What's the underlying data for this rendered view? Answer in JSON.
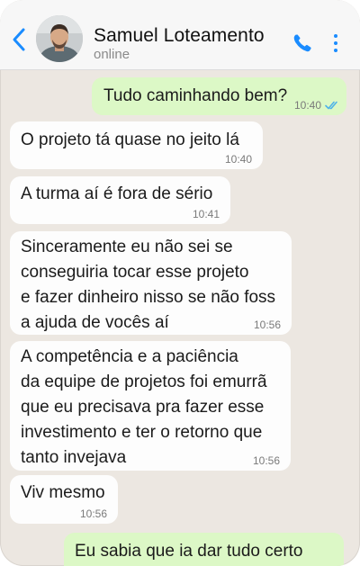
{
  "header": {
    "contact_name": "Samuel Loteamento",
    "status": "online"
  },
  "messages": [
    {
      "direction": "out",
      "text": "Tudo caminhando bem?",
      "time": "10:40",
      "read": true
    },
    {
      "direction": "in",
      "text": "O projeto tá quase no jeito lá",
      "time": "10:40"
    },
    {
      "direction": "in",
      "text": "A turma aí é fora de sério",
      "time": "10:41"
    },
    {
      "direction": "in",
      "lines": [
        "Sinceramente eu não sei se",
        "conseguiria tocar esse projeto",
        "e fazer dinheiro nisso se não foss",
        "a ajuda de vocês aí"
      ],
      "time": "10:56"
    },
    {
      "direction": "in",
      "lines": [
        "A competência e a paciência",
        "da equipe de projetos foi emurrã",
        "que eu precisava pra fazer esse",
        "investimento e ter o retorno que",
        "tanto invejava"
      ],
      "time": "10:56"
    },
    {
      "direction": "in",
      "text": "Viv mesmo",
      "time": "10:56"
    },
    {
      "direction": "out",
      "text": "Eu sabia que ia dar tudo certo"
    }
  ],
  "colors": {
    "chat_background": "#ece7e1",
    "incoming_bubble": "#fdfdfd",
    "outgoing_bubble": "#dcf8c6",
    "accent": "#1a8cff",
    "read_ticks": "#4fb3e8"
  },
  "icons": [
    "back-chevron-icon",
    "phone-icon",
    "more-vertical-icon",
    "double-check-icon"
  ]
}
